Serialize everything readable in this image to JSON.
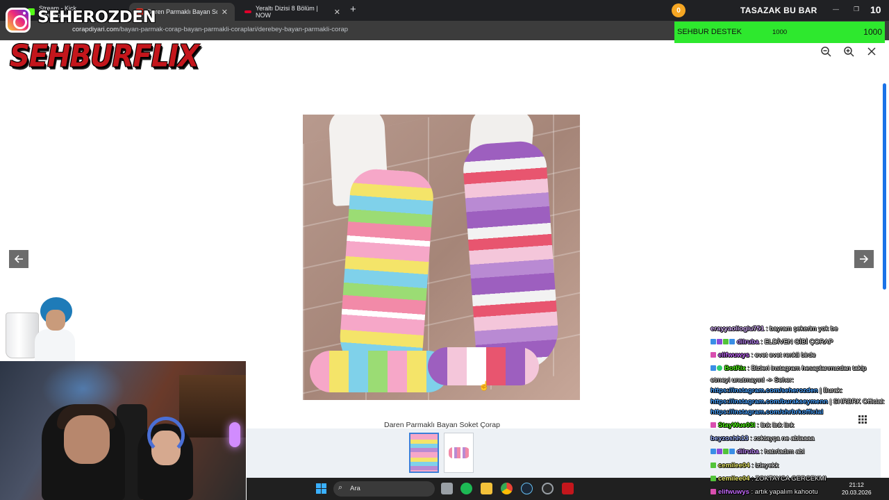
{
  "browser": {
    "tabs": [
      {
        "title": "Stream - Kick Dashboard",
        "favicon_color": "#53fc18",
        "active": false
      },
      {
        "title": "Daren Parmaklı Bayan Soket Ço",
        "favicon_color": "#d93025",
        "active": true
      },
      {
        "title": "Yeraltı Dizisi 8 Bölüm | NOW",
        "favicon_color": "#e0002a",
        "active": false
      }
    ],
    "url_host": "corapdiyari.com",
    "url_path": "/bayan-parmak-corap-bayan-parmakli-coraplari/derebey-bayan-parmakli-corap"
  },
  "overlay": {
    "coin_count": "0",
    "bar_title": "TASAZAK BU BAR",
    "bar_count": "10",
    "support_label": "SEHBUR DESTEK",
    "support_mid": "1000",
    "support_value": "1000",
    "support_color": "#2ee82e",
    "instagram_handle": "SEHEROZDEN",
    "brand_text": "SEHBURFLIX",
    "brand_color": "#c4161c"
  },
  "lightbox": {
    "caption": "Daren Parmaklı Bayan Soket Çorap",
    "zoom_out_icon": "zoom-out-icon",
    "zoom_in_icon": "zoom-in-icon",
    "close_icon": "close-icon",
    "prev_icon": "arrow-left-icon",
    "next_icon": "arrow-right-icon",
    "accent_color": "#1a73e8"
  },
  "taskbar": {
    "search_placeholder": "Ara",
    "time": "21:12",
    "date": "20.03.2026"
  },
  "chat": {
    "messages": [
      {
        "user": "erayyaoliogiu751",
        "user_color": "#d9b4ff",
        "badges": [],
        "text": " : bayram şekerim yok be"
      },
      {
        "user": "dilruba",
        "user_color": "#c18cff",
        "badges": [
          "#3a8ee6",
          "#8a4bd8",
          "#53c43a",
          "#3a8ee6"
        ],
        "text": " : ELDİVEN GİBİ ÇORAP"
      },
      {
        "user": "elifwuwys",
        "user_color": "#c66bff",
        "badges": [
          "#d94fb0"
        ],
        "text": " : evet evet renkli birde"
      },
      {
        "user": "BotRix",
        "user_color": "#53fc18",
        "badges": [
          "#3a8ee6",
          "#2ecc71"
        ],
        "text": " : Bizleri instagram hesaplarımızdan takip etmeyi unutmayın! -> Seher: ",
        "links": [
          "https://instagram.com/seherozden",
          "https://instagram.com/burakseymenn",
          "https://instagram.com/shrbrkofficial"
        ],
        "link_sep_1": " | Burak: ",
        "link_sep_2": " | SHRBRK Official: "
      },
      {
        "user": "StayWue03l",
        "user_color": "#53fc18",
        "badges": [
          "#d94fb0"
        ],
        "text": " : link link link"
      },
      {
        "user": "beyzoshh13",
        "user_color": "#9fb4ff",
        "badges": [],
        "text": " : zoktayça ne ablaaaa"
      },
      {
        "user": "dilruba",
        "user_color": "#c18cff",
        "badges": [
          "#3a8ee6",
          "#8a4bd8",
          "#53c43a",
          "#3a8ee6"
        ],
        "text": " : hatırladım abi"
      },
      {
        "user": "cemilee04",
        "user_color": "#e8e86b",
        "badges": [
          "#53c43a"
        ],
        "text": " : izleyekk"
      },
      {
        "user": "cemilee04",
        "user_color": "#e8e86b",
        "badges": [
          "#53c43a"
        ],
        "text": " : ZOKTAYCA GERCEKMI"
      },
      {
        "user": "elifwuwys",
        "user_color": "#c66bff",
        "badges": [
          "#d94fb0"
        ],
        "text": " : artık yapalım kahootu"
      }
    ]
  }
}
